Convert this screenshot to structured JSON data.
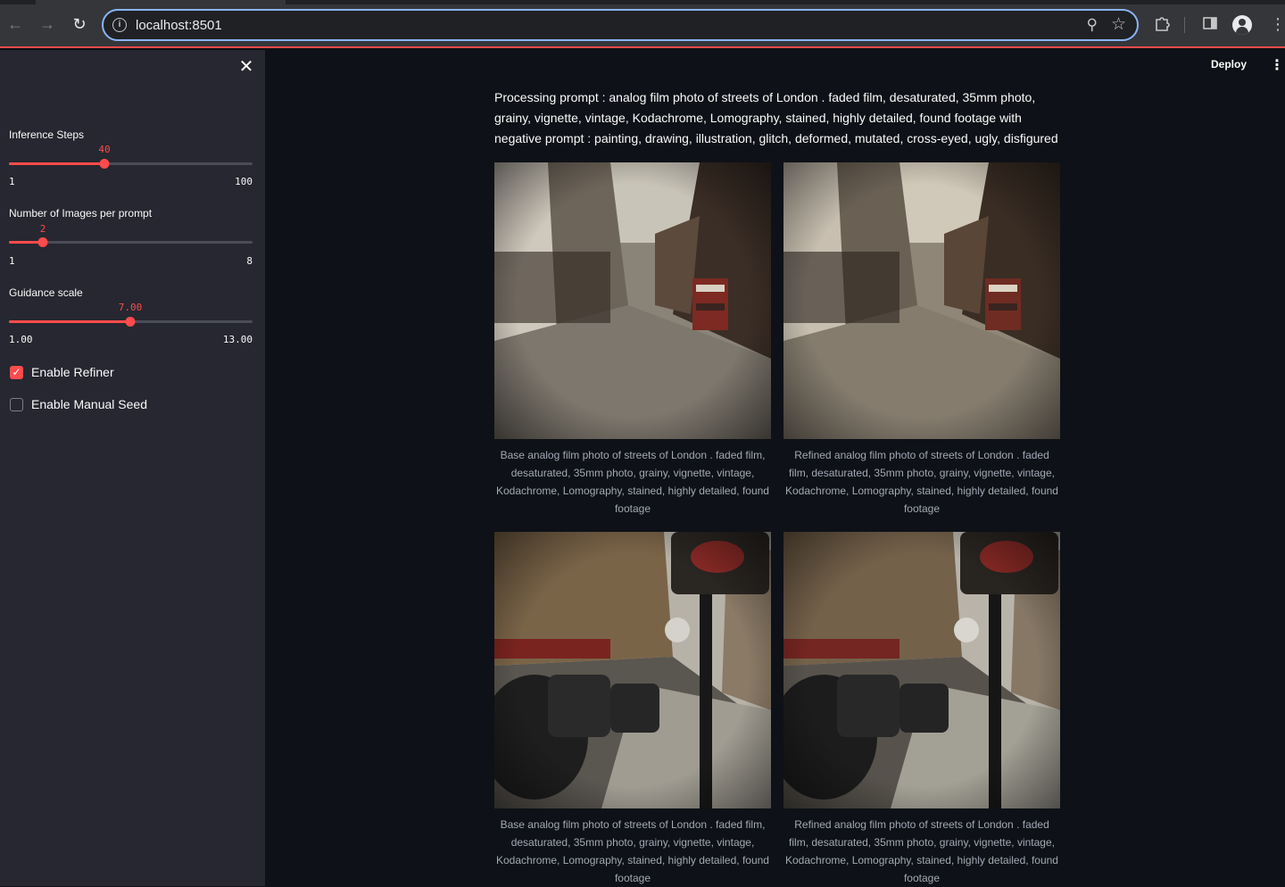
{
  "browser": {
    "url": "localhost:8501",
    "nav_back_icon": "arrow-left-icon",
    "nav_forward_icon": "arrow-right-icon",
    "reload_icon": "reload-icon",
    "site_info_icon": "info-icon",
    "zoom_icon": "magnifier-icon",
    "bookmark_icon": "star-icon",
    "extensions_icon": "puzzle-icon",
    "sidepanel_icon": "side-panel-icon",
    "profile_icon": "person-icon",
    "menu_icon": "kebab-icon"
  },
  "sidebar": {
    "close_icon": "close-icon",
    "sliders": [
      {
        "label": "Inference Steps",
        "value": "40",
        "min": "1",
        "max": "100",
        "fraction": 0.394
      },
      {
        "label": "Number of Images per prompt",
        "value": "2",
        "min": "1",
        "max": "8",
        "fraction": 0.143
      },
      {
        "label": "Guidance scale",
        "value": "7.00",
        "min": "1.00",
        "max": "13.00",
        "fraction": 0.5
      }
    ],
    "checkboxes": [
      {
        "label": "Enable Refiner",
        "checked": true
      },
      {
        "label": "Enable Manual Seed",
        "checked": false
      }
    ]
  },
  "header": {
    "deploy_label": "Deploy",
    "menu_icon": "kebab-icon"
  },
  "main": {
    "prompt_text": "Processing prompt : analog film photo of streets of London . faded film, desaturated, 35mm photo, grainy, vignette, vintage, Kodachrome, Lomography, stained, highly detailed, found footage with negative prompt : painting, drawing, illustration, glitch, deformed, mutated, cross-eyed, ugly, disfigured",
    "images": [
      {
        "caption": "Base analog film photo of streets of London . faded film, desaturated, 35mm photo, grainy, vignette, vintage, Kodachrome, Lomography, stained, highly detailed, found footage"
      },
      {
        "caption": "Refined analog film photo of streets of London . faded film, desaturated, 35mm photo, grainy, vignette, vintage, Kodachrome, Lomography, stained, highly detailed, found footage"
      },
      {
        "caption": "Base analog film photo of streets of London . faded film, desaturated, 35mm photo, grainy, vignette, vintage, Kodachrome, Lomography, stained, highly detailed, found footage"
      },
      {
        "caption": "Refined analog film photo of streets of London . faded film, desaturated, 35mm photo, grainy, vignette, vintage, Kodachrome, Lomography, stained, highly detailed, found footage"
      }
    ]
  },
  "colors": {
    "accent": "#ff4b4b",
    "sidebar_bg": "#262730",
    "main_bg": "#0e1117",
    "text": "#fafafa",
    "caption": "#a3a8b4"
  }
}
